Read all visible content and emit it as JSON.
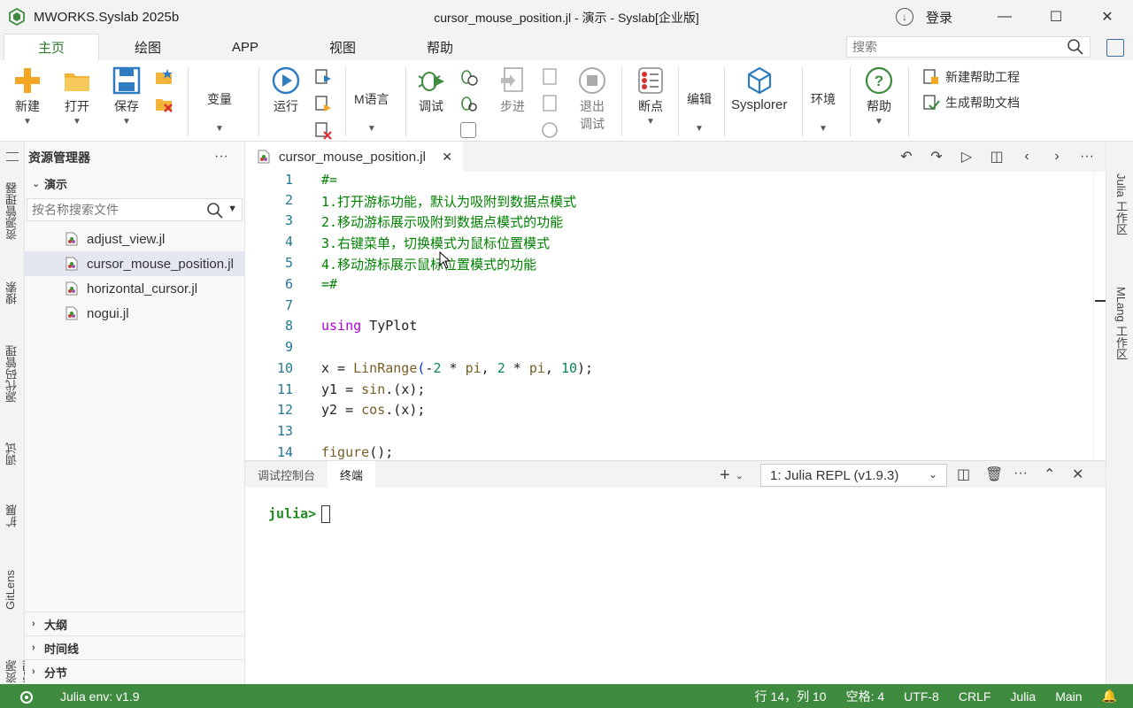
{
  "window": {
    "app_name": "MWORKS.Syslab 2025b",
    "doc_title": "cursor_mouse_position.jl - 演示 - Syslab[企业版]",
    "login_label": "登录"
  },
  "menu": {
    "tabs": [
      "主页",
      "绘图",
      "APP",
      "视图",
      "帮助"
    ],
    "search_placeholder": "搜索"
  },
  "ribbon": {
    "new_label": "新建",
    "open_label": "打开",
    "save_label": "保存",
    "variables_label": "变量",
    "run_label": "运行",
    "mlang_label": "M语言",
    "debug_label": "调试",
    "step_label": "步进",
    "exit_debug_label_1": "退出",
    "exit_debug_label_2": "调试",
    "breakpoint_label": "断点",
    "edit_label": "编辑",
    "sysplorer_label": "Sysplorer",
    "env_label": "环境",
    "help_label": "帮助",
    "new_help_project_label": "新建帮助工程",
    "gen_help_doc_label": "生成帮助文档"
  },
  "activity_bar": {
    "explorer": "资源管理器",
    "search": "搜索",
    "scm": "源代码管理",
    "debug": "调试",
    "extensions": "扩展",
    "gitlens": "GitLens",
    "extra": "资源管理器"
  },
  "explorer": {
    "title": "资源管理器",
    "folder": "演示",
    "search_placeholder": "按名称搜索文件",
    "files": [
      "adjust_view.jl",
      "cursor_mouse_position.jl",
      "horizontal_cursor.jl",
      "nogui.jl"
    ],
    "outline": "大纲",
    "timeline": "时间线",
    "sections": "分节"
  },
  "editor": {
    "tab_title": "cursor_mouse_position.jl",
    "line_numbers": [
      "1",
      "2",
      "3",
      "4",
      "5",
      "6",
      "7",
      "8",
      "9",
      "10",
      "11",
      "12",
      "13",
      "14"
    ],
    "lines": {
      "l1": "#=",
      "l2": "1.打开游标功能，默认为吸附到数据点模式",
      "l3": "2.移动游标展示吸附到数据点模式的功能",
      "l4": "3.右键菜单，切换模式为鼠标位置模式",
      "l5": "4.移动游标展示鼠标位置模式的功能",
      "l6": "=#",
      "l8_kw": "using",
      "l8_mod": " TyPlot",
      "l10": "x = ",
      "l10_fn": "LinRange",
      "l10_a": "-",
      "l10_n1": "2",
      "l10_b": " * ",
      "l10_pi1": "pi",
      "l10_c": ", ",
      "l10_n2": "2",
      "l10_d": " * ",
      "l10_pi2": "pi",
      "l10_e": ", ",
      "l10_n3": "10",
      "l10_f": ");",
      "l11": "y1 = ",
      "l11_fn": "sin",
      "l11_rest": ".(x);",
      "l12": "y2 = ",
      "l12_fn": "cos",
      "l12_rest": ".(x);",
      "l14_fn": "figure",
      "l14_rest": "();"
    }
  },
  "panel": {
    "tab_debug_console": "调试控制台",
    "tab_terminal": "终端",
    "repl_select": "1: Julia REPL (v1.9.3)",
    "prompt": "julia>"
  },
  "right_strip": {
    "julia_ws": "Julia 工作区",
    "mlang_ws": "MLang 工作区"
  },
  "status": {
    "julia_env": "Julia env: v1.9",
    "position": "行 14，列 10",
    "spaces": "空格: 4",
    "encoding": "UTF-8",
    "eol": "CRLF",
    "language": "Julia",
    "branch": "Main"
  }
}
